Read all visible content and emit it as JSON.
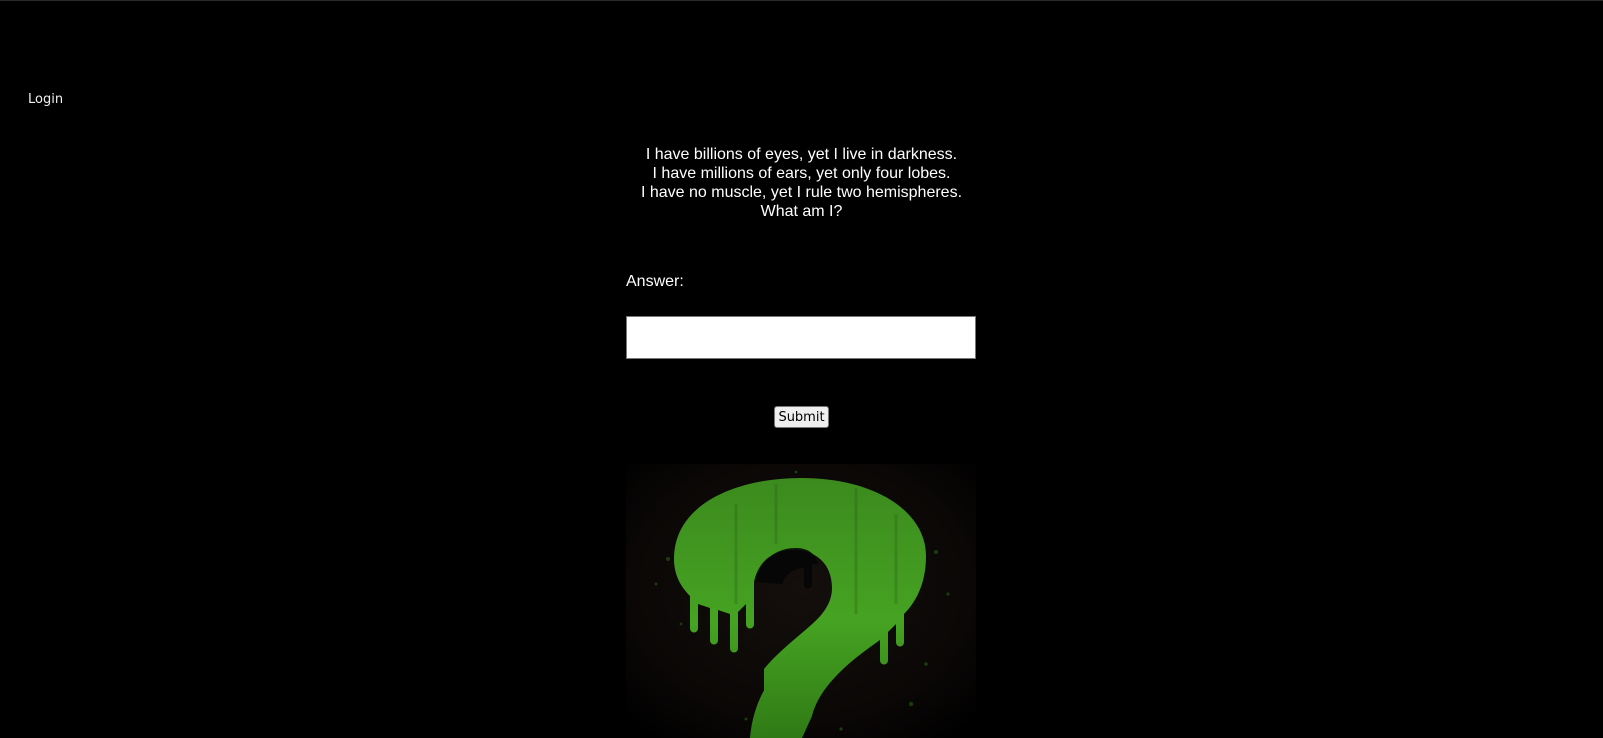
{
  "nav": {
    "login_label": "Login"
  },
  "riddle": {
    "lines": [
      "I have billions of eyes, yet I live in darkness.",
      "I have millions of ears, yet only four lobes.",
      "I have no muscle, yet I rule two hemispheres.",
      "What am I?"
    ]
  },
  "form": {
    "answer_label": "Answer:",
    "answer_value": "",
    "submit_label": "Submit"
  },
  "image": {
    "icon": "green-dripping-question-mark",
    "accent_color": "#3d8a1f"
  }
}
